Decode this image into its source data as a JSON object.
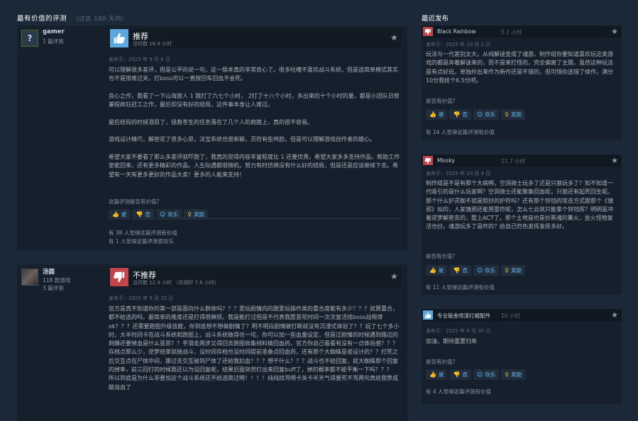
{
  "section": {
    "title": "最有价值的评测",
    "subtitle": "（过去 180 天内）"
  },
  "recent_title": "最近发布",
  "reviews": [
    {
      "author": "gamer",
      "author_stats": "1 篇评测",
      "avatar": "?",
      "verdict": "推荐",
      "verdict_type": "up",
      "hours": "总时数 18.9 小时",
      "posted": "发布于：2025 年 9 月 6 日",
      "body": "可以理解很多差评，但是公平的说一句，这一版本真的非常良心了。很多吐槽不喜欢战斗系统，但是选简单模式其实也不是很难过关，打boss可以一直按回车回血不会死。\n\n良心之作，我看了一下山海旅人 1 我打了六七个小时， 2打了十八个小时，多出来的十个小时的量，都是小团队日夜兼程疯狂赶工之作，最后却没有好的结局，这件事本身让人难过。\n\n最后结局的时候泪目了，拯救苍生的任务落在了几个人的肩膀上，真的很不容易。\n\n游戏设计精巧，解密花了很多心思，法宝系统也很新颖，灵符有些鸡肋，但是可以理解游戏创作者的雄心。\n\n希望大家不要看了那么多差评就吓跑了，我真的觉得内容丰富程度比 1 还要优秀。希望大家多多支持作品，帮助工作室能回来，还有更多精彩的作品。人生际遇都很随机，努力有时仿佛没有什么好的结局，但是还是应该继续下去。希望有一天有更多更好的作品大卖！更多的人能来支持！",
      "helpful_q": "这篇评测是否有价值？",
      "stat1": "有 38 人觉得这篇评测有价值",
      "stat2": "有 1 人觉得这篇评测很欢乐"
    },
    {
      "author": "汤圆",
      "author_stats": "118 款游戏\n3 篇评测",
      "avatar": "",
      "verdict": "不推荐",
      "verdict_type": "down",
      "hours": "总时数 12.9 小时 （评测时 7.8 小时）",
      "posted": "发布于：2025 年 9 月 15 日",
      "body": "官方是真不知道你的第一部是面向什么群体吗？？？爱玩剧情向的跟爱玩操作类的重合度能有多少？？？就算重合，都不给选的吗，最简单的难度还是打得很麻烦，我是能打过但是不代表我愿意花时间一次次复活找boss战规律ok？？？还需要跑图升级技能，你到底想不想做剧情了？明不明白剧情被打断就没有沉浸式体验了？？玩了七个多小时，大半时间卡在战斗系统和跑图上，战斗系统做得也一坨，你可以加一些血量设定，但是过剧情的时候遇到路边的刺棘还要掉血是什么意思？？手滑走两步又得回去跑图收集材料做回血药，官方你自己看看有没有一点体验感？？？存档点那么少，逆梦结束就接战斗，没时间存档也没时间提前准备点回血药，还有那个大蜘蛛是谁设计的？？打死之后交互点在尸体中间，挪过去交互碰到尸体了还给我扣血？？？想干什么？？？战斗也不给回复，就大蜘蛛那个回复的掉率，前三回打的时候我还以为没回复呢，结果后面突然打出来回复buff了，掉的概率都不能平衡一下吗？？？\n所以到底是为什么非要加这个战斗系统还不给选跳过啊！！！！纯纯找骂啊卡关卡半天气得要死不骂两句真给我憋成脑溢血了"
    }
  ],
  "buttons": {
    "yes": "是",
    "no": "否",
    "funny": "欢乐",
    "award": "奖励"
  },
  "recent": [
    {
      "name": "Black Rainbow",
      "hours": "5.2 小时",
      "verdict_type": "down",
      "posted": "发布于：2025 年 10 月 1 日",
      "body": "玩法与一代差别太大，从纯解谜变成了魂游，制作组你要知道喜欢玩这类游戏的都是奔着解谜来的，而不是来打怪的，完全偏离了主题。虽然这种玩法是有点好玩，单独拎出来作为新作还是不错的，但可惜你选错了续作。满分10分我给个6.5分吧。",
      "helpful_q": "是否有价值？",
      "stat": "有 14 人觉得这篇评测有价值"
    },
    {
      "name": "Missky",
      "hours": "11.7 小时",
      "verdict_type": "down",
      "posted": "发布于：2025 年 10 月 4 日",
      "body": "制作组是不是有那个大病啊，空洞骑士玩多了还是只狼玩多了？知不知道一代吸引的是什么玩家啊？空洞骑士还能聚集回血呢，只狼还有起死回生呢。那个什么护灵蜘不就是照抄的护符吗？还有那个铃铛的攻击方式跟那个《镇邪》似的，人家镇邪还能用雷符呢，怎么七云就只能拿个铃铛挥？明明是冲着逆梦解密去的，整上ACT了。那个土地庙也是抄黑魂的篝火，坐火怪物复活也抄。魂游玩多了是咋的？给自己符色发挥发挥多好。",
      "helpful_q": "是否有价值？",
      "stat": "有 11 人觉得这篇评测有价值"
    },
    {
      "name": "专业钣金喷漆打蜡配件",
      "hours": "10 小时",
      "verdict_type": "up",
      "posted": "发布于：2025 年 9 月 30 日",
      "body": "加油，期待重置归来",
      "helpful_q": "是否有价值？",
      "stat": "有 4 人觉得这篇评测有价值"
    }
  ],
  "colors": {
    "bg": "#1b2838",
    "panel": "#16202d",
    "up": "#5ba9de",
    "down": "#c2454b",
    "link": "#67c1f5",
    "award": "#e7c33a"
  }
}
